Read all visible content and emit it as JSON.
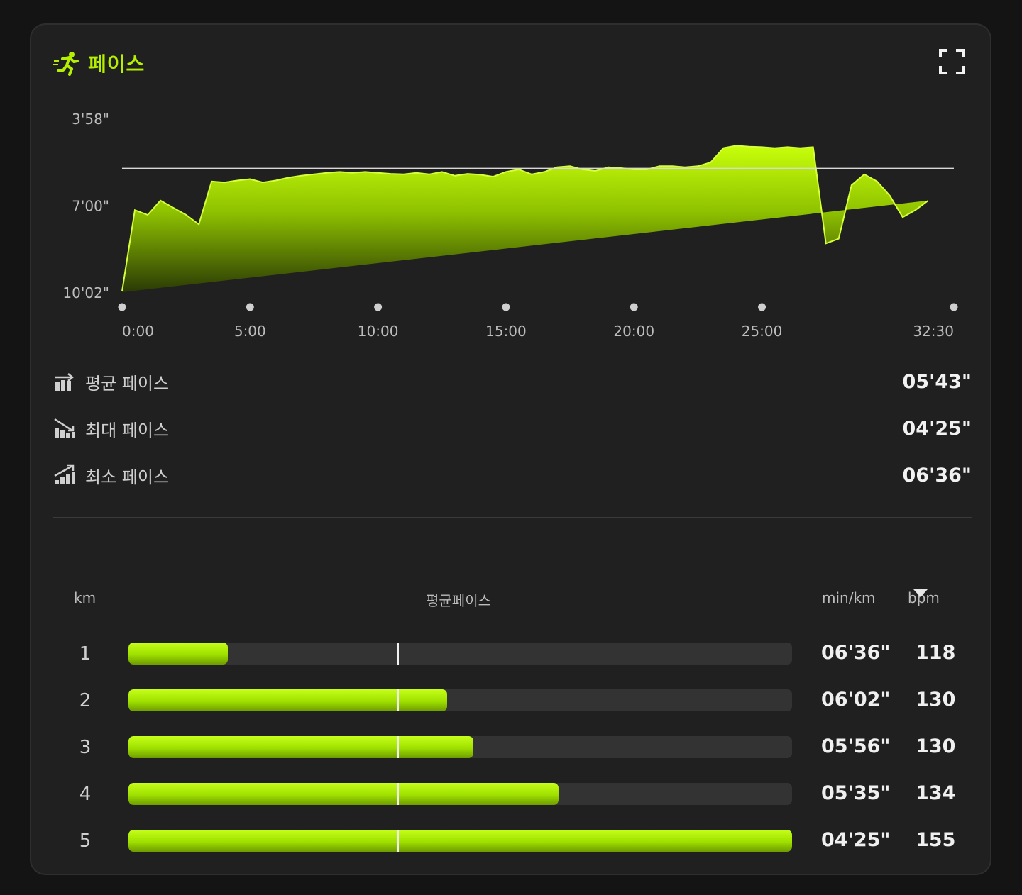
{
  "header": {
    "title": "페이스",
    "icon": "running-icon",
    "expand_icon": "fullscreen-icon"
  },
  "chart_data": {
    "type": "area",
    "y_tick_labels": [
      "3'58\"",
      "7'00\"",
      "10'02\""
    ],
    "x_tick_labels": [
      "0:00",
      "5:00",
      "10:00",
      "15:00",
      "20:00",
      "25:00",
      "32:30"
    ],
    "reference_line": "5'43\"",
    "color": "#b4f000",
    "x": [
      0,
      0.5,
      1,
      1.5,
      2,
      2.5,
      3,
      3.5,
      4,
      4.5,
      5,
      5.5,
      6,
      6.5,
      7,
      7.5,
      8,
      8.5,
      9,
      9.5,
      10,
      10.5,
      11,
      11.5,
      12,
      12.5,
      13,
      13.5,
      14,
      14.5,
      15,
      15.5,
      16,
      16.5,
      17,
      17.5,
      18,
      18.5,
      19,
      19.5,
      20,
      20.5,
      21,
      21.5,
      22,
      22.5,
      23,
      23.5,
      24,
      24.5,
      25,
      25.5,
      26,
      26.5,
      27,
      27.5,
      28,
      28.5,
      29,
      29.5,
      30,
      30.5,
      31,
      31.5,
      32,
      32.5
    ],
    "y_seconds": [
      600,
      430,
      440,
      410,
      425,
      440,
      460,
      370,
      372,
      368,
      365,
      372,
      368,
      362,
      358,
      355,
      352,
      350,
      352,
      350,
      352,
      354,
      355,
      352,
      355,
      350,
      358,
      354,
      356,
      360,
      350,
      345,
      355,
      350,
      340,
      338,
      345,
      348,
      340,
      342,
      345,
      345,
      338,
      338,
      340,
      338,
      330,
      300,
      295,
      297,
      298,
      300,
      298,
      300,
      298,
      500,
      490,
      378,
      355,
      370,
      400,
      445,
      430,
      410
    ]
  },
  "stats": [
    {
      "icon": "average-pace-icon",
      "label": "평균 페이스",
      "value": "05'43\""
    },
    {
      "icon": "max-pace-icon",
      "label": "최대 페이스",
      "value": "04'25\""
    },
    {
      "icon": "min-pace-icon",
      "label": "최소 페이스",
      "value": "06'36\""
    }
  ],
  "splits_table": {
    "headers": {
      "km": "km",
      "avg_pace": "평균페이스",
      "pace_unit": "min/km",
      "bpm": "bpm"
    },
    "sort_icon": "caret-down-icon",
    "average_marker_fraction": 0.405,
    "rows": [
      {
        "km": "1",
        "pace": "06'36\"",
        "bpm": "118",
        "fill": 0.15
      },
      {
        "km": "2",
        "pace": "06'02\"",
        "bpm": "130",
        "fill": 0.48
      },
      {
        "km": "3",
        "pace": "05'56\"",
        "bpm": "130",
        "fill": 0.52
      },
      {
        "km": "4",
        "pace": "05'35\"",
        "bpm": "134",
        "fill": 0.648
      },
      {
        "km": "5",
        "pace": "04'25\"",
        "bpm": "155",
        "fill": 1.0
      }
    ]
  }
}
